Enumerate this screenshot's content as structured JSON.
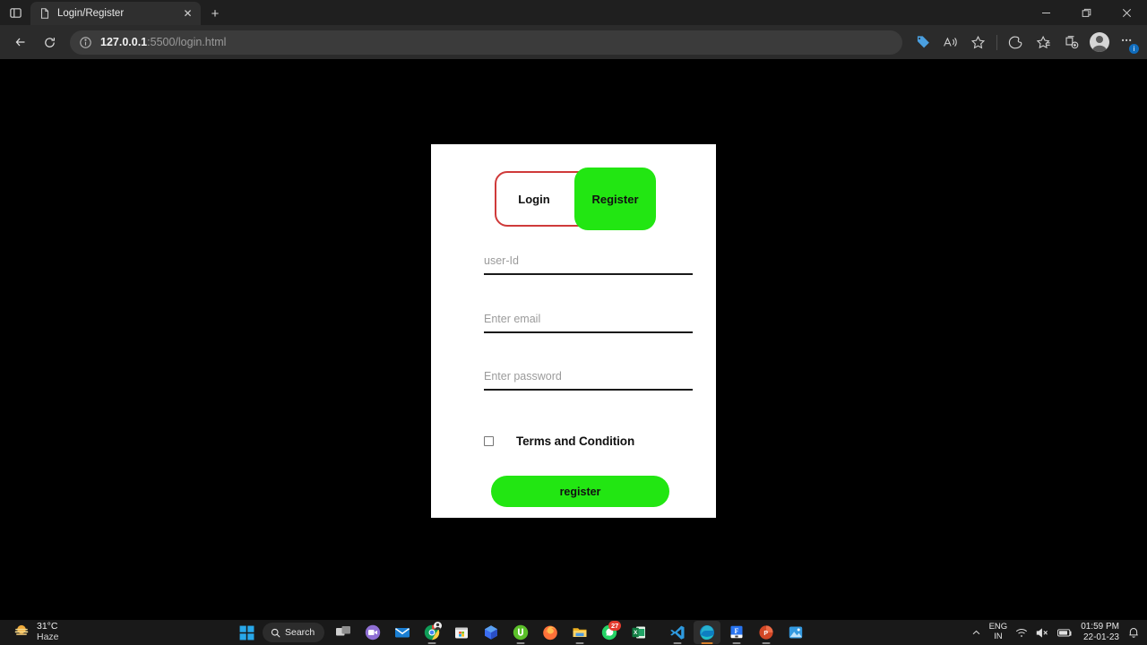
{
  "browser": {
    "tab": {
      "title": "Login/Register",
      "favicon": "page-icon",
      "close_label": "✕"
    },
    "new_tab_label": "+",
    "window_controls": {
      "minimize": "—",
      "restore": "❐",
      "close": "✕"
    },
    "nav": {
      "back": "←",
      "refresh": "⟳"
    },
    "omnibox": {
      "info_icon": "info-icon",
      "url_host": "127.0.0.1",
      "url_rest": ":5500/login.html"
    },
    "toolbar_icons": [
      "shopping-tag-icon",
      "read-aloud-icon",
      "favorite-star-icon",
      "split-screen-icon",
      "favorites-icon",
      "collections-icon",
      "profile-avatar",
      "settings-more-icon"
    ],
    "settings_badge": "i"
  },
  "page": {
    "toggle": {
      "login_label": "Login",
      "register_label": "Register",
      "active": "Register"
    },
    "fields": [
      {
        "name": "user-id",
        "placeholder": "user-Id",
        "value": "",
        "type": "text"
      },
      {
        "name": "email",
        "placeholder": "Enter email",
        "value": "",
        "type": "text"
      },
      {
        "name": "password",
        "placeholder": "Enter password",
        "value": "",
        "type": "text"
      }
    ],
    "terms": {
      "label": "Terms and Condition",
      "checked": false
    },
    "submit_label": "register",
    "colors": {
      "green": "#22e612",
      "toggle_border_red": "#cf3a3a",
      "card_bg": "#ffffff",
      "page_bg": "#000000"
    }
  },
  "taskbar": {
    "weather": {
      "temp": "31°C",
      "condition": "Haze",
      "icon": "haze-sun-icon"
    },
    "start_label": "start-icon",
    "search_label": "Search",
    "apps": [
      {
        "name": "task-view",
        "running": false
      },
      {
        "name": "zoom",
        "running": false
      },
      {
        "name": "mail",
        "running": false
      },
      {
        "name": "chrome",
        "running": true
      },
      {
        "name": "microsoft-store",
        "running": false
      },
      {
        "name": "copilot",
        "running": false
      },
      {
        "name": "utorrent",
        "running": true
      },
      {
        "name": "firefox",
        "running": false
      },
      {
        "name": "file-explorer",
        "running": true
      },
      {
        "name": "whatsapp",
        "running": false,
        "badge": "27"
      },
      {
        "name": "excel",
        "running": false
      },
      {
        "name": "vs-code",
        "running": true
      },
      {
        "name": "edge",
        "running": true,
        "active": true
      },
      {
        "name": "flipkart",
        "running": true
      },
      {
        "name": "powerpoint",
        "running": true
      },
      {
        "name": "photos",
        "running": false
      }
    ],
    "tray": {
      "chevron": "▲",
      "lang_line1": "ENG",
      "lang_line2": "IN",
      "wifi": "wifi-icon",
      "volume": "volume-muted-icon",
      "battery": "battery-icon",
      "time": "01:59 PM",
      "date": "22-01-23",
      "notifications": "notification-bell-icon"
    }
  }
}
